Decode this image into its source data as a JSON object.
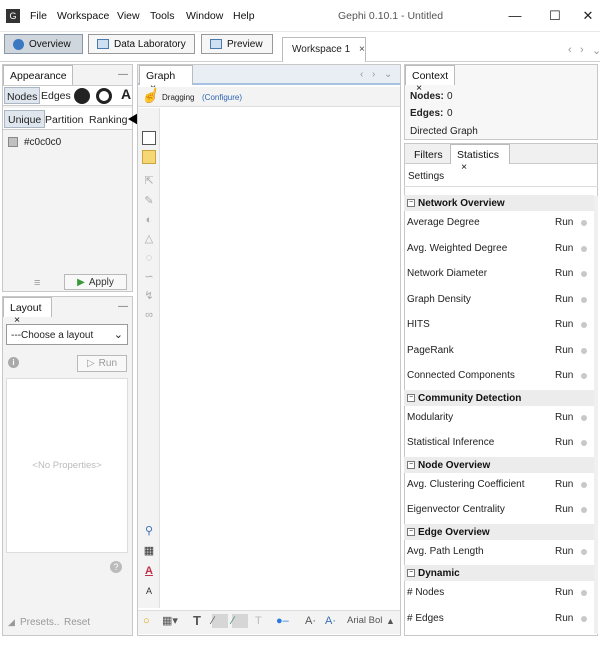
{
  "window": {
    "title": "Gephi 0.10.1 - Untitled",
    "menu": [
      "File",
      "Workspace",
      "View",
      "Tools",
      "Window",
      "Help"
    ]
  },
  "toolbar": {
    "overview": "Overview",
    "data_lab": "Data Laboratory",
    "preview": "Preview",
    "workspace_tab": "Workspace 1"
  },
  "appearance": {
    "tab": "Appearance",
    "nodes": "Nodes",
    "edges": "Edges",
    "modes": [
      "Unique",
      "Partition",
      "Ranking"
    ],
    "color_value": "#c0c0c0",
    "color_swatch": "#c0c0c0",
    "apply": "Apply"
  },
  "layout": {
    "tab": "Layout",
    "choose": "---Choose a layout",
    "run": "Run",
    "no_props": "<No Properties>",
    "presets": "Presets..",
    "reset": "Reset"
  },
  "graph": {
    "tab": "Graph",
    "mode": "Dragging",
    "configure": "(Configure)",
    "font": "Arial Bol"
  },
  "context": {
    "tab": "Context",
    "nodes_label": "Nodes:",
    "nodes_value": "0",
    "edges_label": "Edges:",
    "edges_value": "0",
    "type": "Directed Graph"
  },
  "statistics": {
    "tabs": [
      "Filters",
      "Statistics"
    ],
    "settings": "Settings",
    "sections": [
      {
        "name": "Network Overview",
        "items": [
          "Average Degree",
          "Avg. Weighted Degree",
          "Network Diameter",
          "Graph Density",
          "HITS",
          "PageRank",
          "Connected Components"
        ]
      },
      {
        "name": "Community Detection",
        "items": [
          "Modularity",
          "Statistical Inference"
        ]
      },
      {
        "name": "Node Overview",
        "items": [
          "Avg. Clustering Coefficient",
          "Eigenvector Centrality"
        ]
      },
      {
        "name": "Edge Overview",
        "items": [
          "Avg. Path Length"
        ]
      },
      {
        "name": "Dynamic",
        "items": [
          "# Nodes",
          "# Edges"
        ]
      }
    ],
    "run_label": "Run"
  }
}
